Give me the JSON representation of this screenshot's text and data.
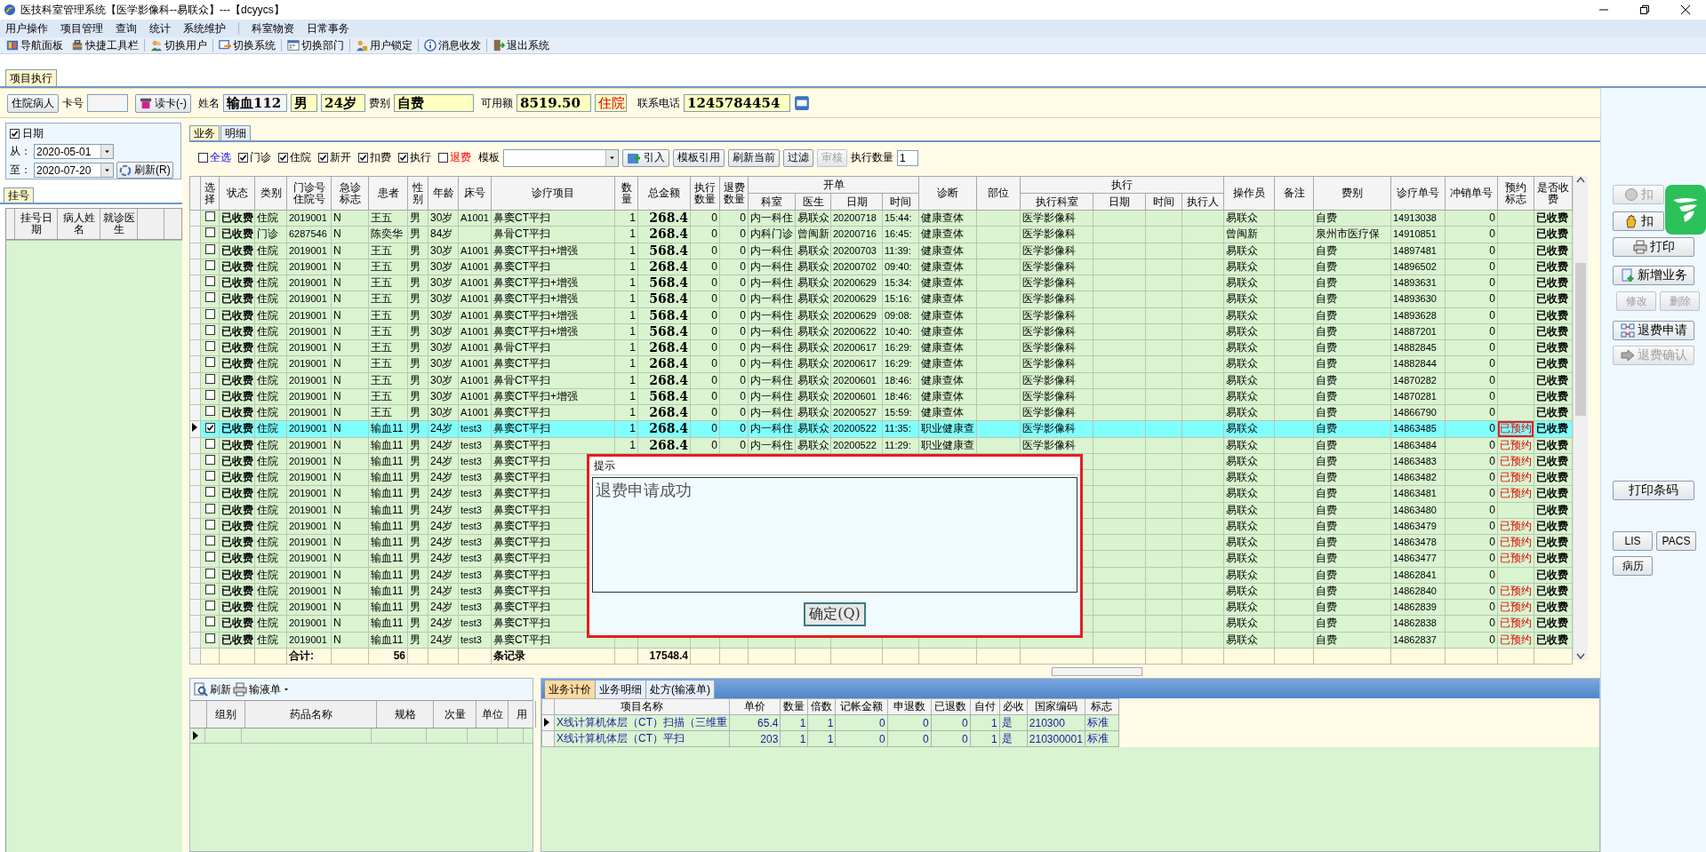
{
  "window": {
    "title": "医技科室管理系统【医学影像科--易联众】---【dcyycs】"
  },
  "menu": [
    "用户操作",
    "项目管理",
    "查询",
    "统计",
    "系统维护",
    "科室物资",
    "日常事务"
  ],
  "toolbar": [
    "导航面板",
    "快捷工具栏",
    "切换用户",
    "切换系统",
    "切换部门",
    "用户锁定",
    "消息收发",
    "退出系统"
  ],
  "page_tabs": [
    {
      "label": "项目执行",
      "selected": true
    }
  ],
  "patient": {
    "type_button": "住院病人",
    "card_label": "卡号",
    "read_card_button": "读卡(-)",
    "name_label": "姓名",
    "name": "输血112",
    "sex": "男",
    "age": "24岁",
    "fee_label": "费别",
    "fee_type": "自费",
    "balance_label": "可用额",
    "balance": "8519.50",
    "status": "住院",
    "phone_label": "联系电话",
    "phone": "1245784454"
  },
  "date_filter": {
    "label": "日期",
    "checked": true,
    "from_label": "从：",
    "from": "2020-05-01",
    "to_label": "至：",
    "to": "2020-07-20",
    "refresh_button": "刷新(R)"
  },
  "register": {
    "tabs": [
      {
        "label": "挂号",
        "selected": true
      }
    ],
    "columns": [
      "挂号日期",
      "病人姓名",
      "就诊医生"
    ]
  },
  "work_tabs": [
    {
      "label": "业务",
      "selected": true
    },
    {
      "label": "明细",
      "selected": false
    }
  ],
  "filters": [
    {
      "label": "全选",
      "checked": false,
      "kind": "all"
    },
    {
      "label": "门诊",
      "checked": true,
      "kind": "option"
    },
    {
      "label": "住院",
      "checked": true,
      "kind": "option"
    },
    {
      "label": "新开",
      "checked": true,
      "kind": "option"
    },
    {
      "label": "扣费",
      "checked": true,
      "kind": "option"
    },
    {
      "label": "执行",
      "checked": true,
      "kind": "option"
    },
    {
      "label": "退费",
      "checked": false,
      "kind": "refund"
    }
  ],
  "template_label": "模板",
  "actions": [
    {
      "label": "引入",
      "disabled": false
    },
    {
      "label": "模板引用",
      "disabled": false
    },
    {
      "label": "刷新当前",
      "disabled": false
    },
    {
      "label": "过滤",
      "disabled": false
    },
    {
      "label": "审核",
      "disabled": true
    }
  ],
  "exec_qty_label": "执行数量",
  "exec_qty": "1",
  "table": {
    "columns": [
      {
        "label": "选择"
      },
      {
        "label": "状态"
      },
      {
        "label": "类别"
      },
      {
        "label": "门诊号住院号"
      },
      {
        "label": "急诊标志"
      },
      {
        "label": "患者"
      },
      {
        "label": "性别"
      },
      {
        "label": "年龄"
      },
      {
        "label": "床号"
      },
      {
        "label": "诊疗项目"
      },
      {
        "label": "数量"
      },
      {
        "label": "总金额"
      },
      {
        "label": "执行数量"
      },
      {
        "label": "退费数量"
      },
      {
        "label": "开单",
        "children": [
          "科室",
          "医生",
          "日期",
          "时间"
        ]
      },
      {
        "label": "诊断"
      },
      {
        "label": "部位"
      },
      {
        "label": "执行",
        "children": [
          "执行科室",
          "日期",
          "时间",
          "执行人"
        ]
      },
      {
        "label": "操作员"
      },
      {
        "label": "备注"
      },
      {
        "label": "费别"
      },
      {
        "label": "诊疗单号"
      },
      {
        "label": "冲销单号"
      },
      {
        "label": "预约标志"
      },
      {
        "label": "是否收费"
      }
    ],
    "rows": [
      {
        "st": "已收费",
        "cat": "住院",
        "no": "2019001",
        "em": "N",
        "pt": "王五",
        "sex": "男",
        "age": "30岁",
        "bed": "A1001",
        "item": "鼻窦CT平扫",
        "qty": "1",
        "amt": "268.4",
        "eq": "0",
        "rq": "0",
        "dept": "内一科住",
        "doc": "易联众",
        "date": "20200718",
        "time": "15:44:",
        "diag": "健康查体",
        "edept": "医学影像科",
        "op": "易联众",
        "fee": "自费",
        "ono": "14913038",
        "rno": "0",
        "paid": "已收费",
        "selected": false,
        "checked": false,
        "framed": false
      },
      {
        "st": "已收费",
        "cat": "门诊",
        "no": "6287546",
        "em": "N",
        "pt": "陈奕华",
        "sex": "男",
        "age": "84岁",
        "item": "鼻骨CT平扫",
        "qty": "1",
        "amt": "268.4",
        "eq": "0",
        "rq": "0",
        "dept": "内科门诊",
        "doc": "曾闽新",
        "date": "20200716",
        "time": "16:45:",
        "diag": "健康查体",
        "edept": "医学影像科",
        "op": "曾闽新",
        "fee": "泉州市医疗保",
        "ono": "14910851",
        "rno": "0",
        "paid": "已收费",
        "selected": false,
        "checked": false,
        "framed": false
      },
      {
        "st": "已收费",
        "cat": "住院",
        "no": "2019001",
        "em": "N",
        "pt": "王五",
        "sex": "男",
        "age": "30岁",
        "bed": "A1001",
        "item": "鼻窦CT平扫+增强",
        "qty": "1",
        "amt": "568.4",
        "eq": "0",
        "rq": "0",
        "dept": "内一科住",
        "doc": "易联众",
        "date": "20200703",
        "time": "11:39:",
        "diag": "健康查体",
        "edept": "医学影像科",
        "op": "易联众",
        "fee": "自费",
        "ono": "14897481",
        "rno": "0",
        "paid": "已收费",
        "selected": false,
        "checked": false,
        "framed": false
      },
      {
        "st": "已收费",
        "cat": "住院",
        "no": "2019001",
        "em": "N",
        "pt": "王五",
        "sex": "男",
        "age": "30岁",
        "bed": "A1001",
        "item": "鼻窦CT平扫",
        "qty": "1",
        "amt": "268.4",
        "eq": "0",
        "rq": "0",
        "dept": "内一科住",
        "doc": "易联众",
        "date": "20200702",
        "time": "09:40:",
        "diag": "健康查体",
        "edept": "医学影像科",
        "op": "易联众",
        "fee": "自费",
        "ono": "14896502",
        "rno": "0",
        "paid": "已收费",
        "selected": false,
        "checked": false,
        "framed": false
      },
      {
        "st": "已收费",
        "cat": "住院",
        "no": "2019001",
        "em": "N",
        "pt": "王五",
        "sex": "男",
        "age": "30岁",
        "bed": "A1001",
        "item": "鼻窦CT平扫+增强",
        "qty": "1",
        "amt": "568.4",
        "eq": "0",
        "rq": "0",
        "dept": "内一科住",
        "doc": "易联众",
        "date": "20200629",
        "time": "15:34:",
        "diag": "健康查体",
        "edept": "医学影像科",
        "op": "易联众",
        "fee": "自费",
        "ono": "14893631",
        "rno": "0",
        "paid": "已收费",
        "selected": false,
        "checked": false,
        "framed": false
      },
      {
        "st": "已收费",
        "cat": "住院",
        "no": "2019001",
        "em": "N",
        "pt": "王五",
        "sex": "男",
        "age": "30岁",
        "bed": "A1001",
        "item": "鼻窦CT平扫+增强",
        "qty": "1",
        "amt": "568.4",
        "eq": "0",
        "rq": "0",
        "dept": "内一科住",
        "doc": "易联众",
        "date": "20200629",
        "time": "15:16:",
        "diag": "健康查体",
        "edept": "医学影像科",
        "op": "易联众",
        "fee": "自费",
        "ono": "14893630",
        "rno": "0",
        "paid": "已收费",
        "selected": false,
        "checked": false,
        "framed": false
      },
      {
        "st": "已收费",
        "cat": "住院",
        "no": "2019001",
        "em": "N",
        "pt": "王五",
        "sex": "男",
        "age": "30岁",
        "bed": "A1001",
        "item": "鼻窦CT平扫+增强",
        "qty": "1",
        "amt": "568.4",
        "eq": "0",
        "rq": "0",
        "dept": "内一科住",
        "doc": "易联众",
        "date": "20200629",
        "time": "09:08:",
        "diag": "健康查体",
        "edept": "医学影像科",
        "op": "易联众",
        "fee": "自费",
        "ono": "14893628",
        "rno": "0",
        "paid": "已收费",
        "selected": false,
        "checked": false,
        "framed": false
      },
      {
        "st": "已收费",
        "cat": "住院",
        "no": "2019001",
        "em": "N",
        "pt": "王五",
        "sex": "男",
        "age": "30岁",
        "bed": "A1001",
        "item": "鼻窦CT平扫+增强",
        "qty": "1",
        "amt": "568.4",
        "eq": "0",
        "rq": "0",
        "dept": "内一科住",
        "doc": "易联众",
        "date": "20200622",
        "time": "10:40:",
        "diag": "健康查体",
        "edept": "医学影像科",
        "op": "易联众",
        "fee": "自费",
        "ono": "14887201",
        "rno": "0",
        "paid": "已收费",
        "selected": false,
        "checked": false,
        "framed": false
      },
      {
        "st": "已收费",
        "cat": "住院",
        "no": "2019001",
        "em": "N",
        "pt": "王五",
        "sex": "男",
        "age": "30岁",
        "bed": "A1001",
        "item": "鼻骨CT平扫",
        "qty": "1",
        "amt": "268.4",
        "eq": "0",
        "rq": "0",
        "dept": "内一科住",
        "doc": "易联众",
        "date": "20200617",
        "time": "16:29:",
        "diag": "健康查体",
        "edept": "医学影像科",
        "op": "易联众",
        "fee": "自费",
        "ono": "14882845",
        "rno": "0",
        "paid": "已收费",
        "selected": false,
        "checked": false,
        "framed": false
      },
      {
        "st": "已收费",
        "cat": "住院",
        "no": "2019001",
        "em": "N",
        "pt": "王五",
        "sex": "男",
        "age": "30岁",
        "bed": "A1001",
        "item": "鼻窦CT平扫",
        "qty": "1",
        "amt": "268.4",
        "eq": "0",
        "rq": "0",
        "dept": "内一科住",
        "doc": "易联众",
        "date": "20200617",
        "time": "16:29:",
        "diag": "健康查体",
        "edept": "医学影像科",
        "op": "易联众",
        "fee": "自费",
        "ono": "14882844",
        "rno": "0",
        "paid": "已收费",
        "selected": false,
        "checked": false,
        "framed": false
      },
      {
        "st": "已收费",
        "cat": "住院",
        "no": "2019001",
        "em": "N",
        "pt": "王五",
        "sex": "男",
        "age": "30岁",
        "bed": "A1001",
        "item": "鼻骨CT平扫",
        "qty": "1",
        "amt": "268.4",
        "eq": "0",
        "rq": "0",
        "dept": "内一科住",
        "doc": "易联众",
        "date": "20200601",
        "time": "18:46:",
        "diag": "健康查体",
        "edept": "医学影像科",
        "op": "易联众",
        "fee": "自费",
        "ono": "14870282",
        "rno": "0",
        "paid": "已收费",
        "selected": false,
        "checked": false,
        "framed": false
      },
      {
        "st": "已收费",
        "cat": "住院",
        "no": "2019001",
        "em": "N",
        "pt": "王五",
        "sex": "男",
        "age": "30岁",
        "bed": "A1001",
        "item": "鼻窦CT平扫+增强",
        "qty": "1",
        "amt": "568.4",
        "eq": "0",
        "rq": "0",
        "dept": "内一科住",
        "doc": "易联众",
        "date": "20200601",
        "time": "18:46:",
        "diag": "健康查体",
        "edept": "医学影像科",
        "op": "易联众",
        "fee": "自费",
        "ono": "14870281",
        "rno": "0",
        "paid": "已收费",
        "selected": false,
        "checked": false,
        "framed": false
      },
      {
        "st": "已收费",
        "cat": "住院",
        "no": "2019001",
        "em": "N",
        "pt": "王五",
        "sex": "男",
        "age": "30岁",
        "bed": "A1001",
        "item": "鼻窦CT平扫",
        "qty": "1",
        "amt": "268.4",
        "eq": "0",
        "rq": "0",
        "dept": "内一科住",
        "doc": "易联众",
        "date": "20200527",
        "time": "15:59:",
        "diag": "健康查体",
        "edept": "医学影像科",
        "op": "易联众",
        "fee": "自费",
        "ono": "14866790",
        "rno": "0",
        "paid": "已收费",
        "selected": false,
        "checked": false,
        "framed": false
      },
      {
        "st": "已收费",
        "cat": "住院",
        "no": "2019001",
        "em": "N",
        "pt": "输血11",
        "sex": "男",
        "age": "24岁",
        "bed": "test3",
        "item": "鼻窦CT平扫",
        "qty": "1",
        "amt": "268.4",
        "eq": "0",
        "rq": "0",
        "dept": "内一科住",
        "doc": "易联众",
        "date": "20200522",
        "time": "11:35:",
        "diag": "职业健康查",
        "edept": "医学影像科",
        "op": "易联众",
        "fee": "自费",
        "ono": "14863485",
        "rno": "0",
        "book": "已预约",
        "paid": "已收费",
        "selected": true,
        "checked": true,
        "framed": true
      },
      {
        "st": "已收费",
        "cat": "住院",
        "no": "2019001",
        "em": "N",
        "pt": "输血11",
        "sex": "男",
        "age": "24岁",
        "bed": "test3",
        "item": "鼻窦CT平扫",
        "qty": "1",
        "amt": "268.4",
        "eq": "0",
        "rq": "0",
        "dept": "内一科住",
        "doc": "易联众",
        "date": "20200522",
        "time": "11:29:",
        "diag": "职业健康查",
        "edept": "医学影像科",
        "op": "易联众",
        "fee": "自费",
        "ono": "14863484",
        "rno": "0",
        "book": "已预约",
        "paid": "已收费",
        "selected": false,
        "checked": false,
        "framed": false
      },
      {
        "st": "已收费",
        "cat": "住院",
        "no": "2019001",
        "em": "N",
        "pt": "输血11",
        "sex": "男",
        "age": "24岁",
        "bed": "test3",
        "item": "鼻窦CT平扫",
        "op": "易联众",
        "fee": "自费",
        "ono": "14863483",
        "rno": "0",
        "book": "已预约",
        "paid": "已收费",
        "selected": false,
        "checked": false,
        "framed": false
      },
      {
        "st": "已收费",
        "cat": "住院",
        "no": "2019001",
        "em": "N",
        "pt": "输血11",
        "sex": "男",
        "age": "24岁",
        "bed": "test3",
        "item": "鼻窦CT平扫",
        "op": "易联众",
        "fee": "自费",
        "ono": "14863482",
        "rno": "0",
        "book": "已预约",
        "paid": "已收费",
        "selected": false,
        "checked": false,
        "framed": false
      },
      {
        "st": "已收费",
        "cat": "住院",
        "no": "2019001",
        "em": "N",
        "pt": "输血11",
        "sex": "男",
        "age": "24岁",
        "bed": "test3",
        "item": "鼻窦CT平扫",
        "op": "易联众",
        "fee": "自费",
        "ono": "14863481",
        "rno": "0",
        "book": "已预约",
        "paid": "已收费",
        "selected": false,
        "checked": false,
        "framed": false
      },
      {
        "st": "已收费",
        "cat": "住院",
        "no": "2019001",
        "em": "N",
        "pt": "输血11",
        "sex": "男",
        "age": "24岁",
        "bed": "test3",
        "item": "鼻窦CT平扫",
        "op": "易联众",
        "fee": "自费",
        "ono": "14863480",
        "rno": "0",
        "paid": "已收费",
        "selected": false,
        "checked": false,
        "framed": false
      },
      {
        "st": "已收费",
        "cat": "住院",
        "no": "2019001",
        "em": "N",
        "pt": "输血11",
        "sex": "男",
        "age": "24岁",
        "bed": "test3",
        "item": "鼻窦CT平扫",
        "op": "易联众",
        "fee": "自费",
        "ono": "14863479",
        "rno": "0",
        "book": "已预约",
        "paid": "已收费",
        "selected": false,
        "checked": false,
        "framed": false
      },
      {
        "st": "已收费",
        "cat": "住院",
        "no": "2019001",
        "em": "N",
        "pt": "输血11",
        "sex": "男",
        "age": "24岁",
        "bed": "test3",
        "item": "鼻窦CT平扫",
        "op": "易联众",
        "fee": "自费",
        "ono": "14863478",
        "rno": "0",
        "book": "已预约",
        "paid": "已收费",
        "selected": false,
        "checked": false,
        "framed": false
      },
      {
        "st": "已收费",
        "cat": "住院",
        "no": "2019001",
        "em": "N",
        "pt": "输血11",
        "sex": "男",
        "age": "24岁",
        "bed": "test3",
        "item": "鼻窦CT平扫",
        "op": "易联众",
        "fee": "自费",
        "ono": "14863477",
        "rno": "0",
        "book": "已预约",
        "paid": "已收费",
        "selected": false,
        "checked": false,
        "framed": false
      },
      {
        "st": "已收费",
        "cat": "住院",
        "no": "2019001",
        "em": "N",
        "pt": "输血11",
        "sex": "男",
        "age": "24岁",
        "bed": "test3",
        "item": "鼻窦CT平扫",
        "op": "易联众",
        "fee": "自费",
        "ono": "14862841",
        "rno": "0",
        "paid": "已收费",
        "selected": false,
        "checked": false,
        "framed": false
      },
      {
        "st": "已收费",
        "cat": "住院",
        "no": "2019001",
        "em": "N",
        "pt": "输血11",
        "sex": "男",
        "age": "24岁",
        "bed": "test3",
        "item": "鼻窦CT平扫",
        "op": "易联众",
        "fee": "自费",
        "ono": "14862840",
        "rno": "0",
        "book": "已预约",
        "paid": "已收费",
        "selected": false,
        "checked": false,
        "framed": false
      },
      {
        "st": "已收费",
        "cat": "住院",
        "no": "2019001",
        "em": "N",
        "pt": "输血11",
        "sex": "男",
        "age": "24岁",
        "bed": "test3",
        "item": "鼻窦CT平扫",
        "op": "易联众",
        "fee": "自费",
        "ono": "14862839",
        "rno": "0",
        "book": "已预约",
        "paid": "已收费",
        "selected": false,
        "checked": false,
        "framed": false
      },
      {
        "st": "已收费",
        "cat": "住院",
        "no": "2019001",
        "em": "N",
        "pt": "输血11",
        "sex": "男",
        "age": "24岁",
        "bed": "test3",
        "item": "鼻窦CT平扫",
        "op": "易联众",
        "fee": "自费",
        "ono": "14862838",
        "rno": "0",
        "book": "已预约",
        "paid": "已收费",
        "selected": false,
        "checked": false,
        "framed": false
      },
      {
        "st": "已收费",
        "cat": "住院",
        "no": "2019001",
        "em": "N",
        "pt": "输血11",
        "sex": "男",
        "age": "24岁",
        "bed": "test3",
        "item": "鼻窦CT平扫",
        "op": "易联众",
        "fee": "自费",
        "ono": "14862837",
        "rno": "0",
        "book": "已预约",
        "paid": "已收费",
        "selected": false,
        "checked": false,
        "framed": false
      }
    ],
    "total": {
      "label": "合计:",
      "count": "56",
      "unit": "条记录",
      "amount": "17548.4"
    }
  },
  "dialog": {
    "title": "提示",
    "message": "退费申请成功",
    "button": "确定(Q)"
  },
  "drug_panel": {
    "refresh": "刷新",
    "infusion": "输液单",
    "columns": [
      "组别",
      "药品名称",
      "规格",
      "次量",
      "单位",
      "用"
    ]
  },
  "pricing": {
    "tabs": [
      {
        "label": "业务计价",
        "selected": true
      },
      {
        "label": "业务明细",
        "selected": false
      },
      {
        "label": "处方(输液单)",
        "selected": false
      }
    ],
    "columns": [
      "项目名称",
      "单价",
      "数量",
      "倍数",
      "记帐金额",
      "申退数",
      "已退数",
      "自付",
      "必收",
      "国家编码",
      "标志"
    ],
    "rows": [
      {
        "selected": true,
        "cells": [
          "X线计算机体层（CT）扫描（三维重",
          "65.4",
          "1",
          "1",
          "0",
          "0",
          "0",
          "1",
          "是",
          "210300",
          "标准"
        ]
      },
      {
        "selected": false,
        "cells": [
          "X线计算机体层（CT）平扫",
          "203",
          "1",
          "1",
          "0",
          "0",
          "0",
          "1",
          "是",
          "210300001",
          "标准"
        ]
      }
    ]
  },
  "side_buttons": [
    {
      "label": "扣",
      "disabled": true
    },
    {
      "label": "扣",
      "disabled": false
    },
    {
      "label": "打印",
      "disabled": false
    },
    {
      "label": "新增业务",
      "disabled": false
    },
    {
      "label": "修改",
      "disabled": true
    },
    {
      "label": "删除",
      "disabled": true
    },
    {
      "label": "退费申请",
      "disabled": false
    },
    {
      "label": "退费确认",
      "disabled": true
    },
    {
      "label": "打印条码",
      "disabled": false
    },
    {
      "label": "LIS",
      "disabled": false
    },
    {
      "label": "PACS",
      "disabled": false
    },
    {
      "label": "病历",
      "disabled": false
    }
  ]
}
